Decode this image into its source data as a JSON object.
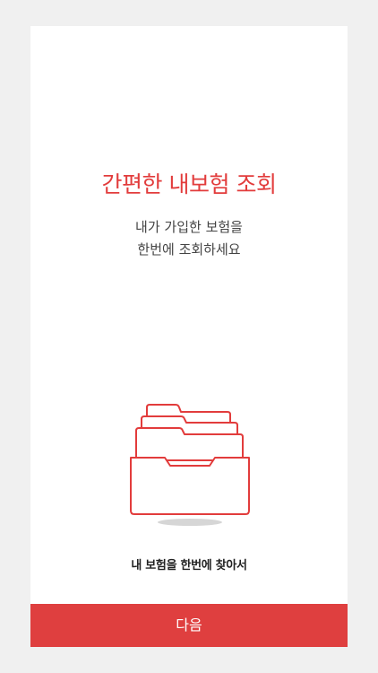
{
  "main": {
    "title": "간편한 내보험 조회",
    "subtitle_line1": "내가 가입한 보험을",
    "subtitle_line2": "한번에 조회하세요",
    "caption": "내 보험을 한번에 찾아서",
    "illustration_icon": "file-drawer-icon"
  },
  "footer": {
    "next_label": "다음"
  },
  "colors": {
    "accent": "#e23c3c",
    "button": "#df3f3f",
    "background": "#f0f0f0",
    "card": "#ffffff"
  }
}
